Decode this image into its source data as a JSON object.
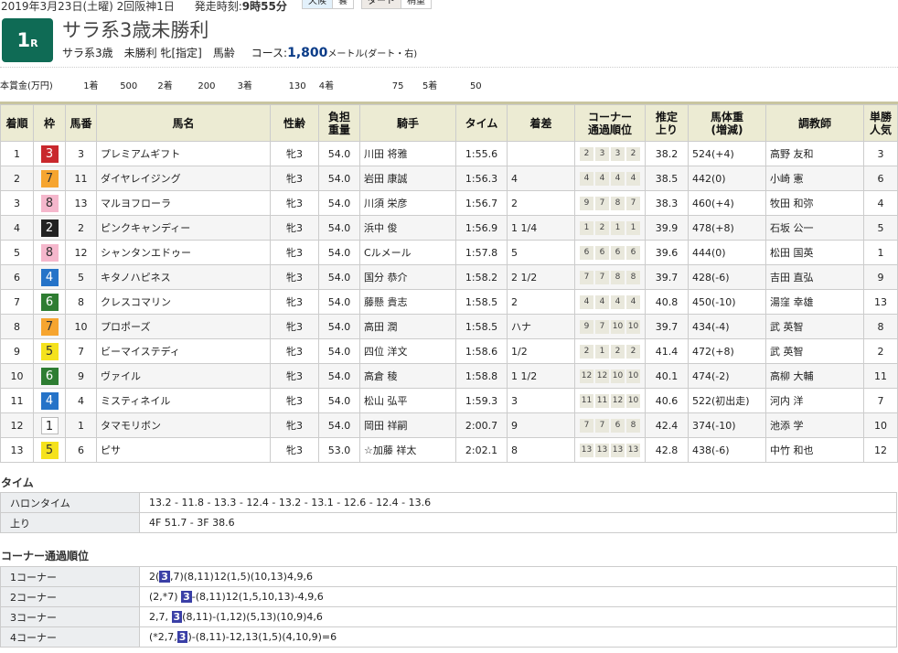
{
  "header": {
    "date_line": "2019年3月23日(土曜) 2回阪神1日",
    "start_label": "発走時刻:",
    "start_time": "9時55分",
    "weather_label": "天候",
    "weather": "曇",
    "track_label": "ダート",
    "track_condition": "稍重",
    "race_number": "1",
    "race_suffix": "R",
    "race_title": "サラ系3歳未勝利",
    "conditions": "サラ系3歳　未勝利 牝[指定]　馬齢",
    "course_label": "コース:",
    "distance": "1,800",
    "course_suffix": "メートル(ダート・右)"
  },
  "prize": {
    "label": "本賞金(万円)",
    "items": [
      {
        "place": "1着",
        "amount": "500"
      },
      {
        "place": "2着",
        "amount": "200"
      },
      {
        "place": "3着",
        "amount": "130"
      },
      {
        "place": "4着",
        "amount": "75"
      },
      {
        "place": "5着",
        "amount": "50"
      }
    ]
  },
  "columns": [
    "着順",
    "枠",
    "馬番",
    "馬名",
    "性齢",
    "負担\n重量",
    "騎手",
    "タイム",
    "着差",
    "コーナー\n通過順位",
    "推定\n上り",
    "馬体重\n(増減)",
    "調教師",
    "単勝\n人気"
  ],
  "waku_colors": {
    "1": {
      "bg": "#ffffff",
      "fg": "#222222"
    },
    "2": {
      "bg": "#222222",
      "fg": "#ffffff"
    },
    "3": {
      "bg": "#c9282d",
      "fg": "#ffffff"
    },
    "4": {
      "bg": "#2573c8",
      "fg": "#ffffff"
    },
    "5": {
      "bg": "#f5e21c",
      "fg": "#333333"
    },
    "6": {
      "bg": "#2e7d32",
      "fg": "#ffffff"
    },
    "7": {
      "bg": "#f6a530",
      "fg": "#333333"
    },
    "8": {
      "bg": "#f5b7cc",
      "fg": "#333333"
    }
  },
  "results": [
    {
      "pos": "1",
      "waku": "3",
      "num": "3",
      "name": "プレミアムギフト",
      "sexage": "牝3",
      "weight": "54.0",
      "jockey": "川田 将雅",
      "time": "1:55.6",
      "margin": "",
      "pass": [
        "2",
        "3",
        "3",
        "2"
      ],
      "last3f": "38.2",
      "body": "524(+4)",
      "trainer": "高野 友和",
      "pop": "3"
    },
    {
      "pos": "2",
      "waku": "7",
      "num": "11",
      "name": "ダイヤレイジング",
      "sexage": "牝3",
      "weight": "54.0",
      "jockey": "岩田 康誠",
      "time": "1:56.3",
      "margin": "4",
      "pass": [
        "4",
        "4",
        "4",
        "4"
      ],
      "last3f": "38.5",
      "body": "442(0)",
      "trainer": "小崎 憲",
      "pop": "6"
    },
    {
      "pos": "3",
      "waku": "8",
      "num": "13",
      "name": "マルヨフローラ",
      "sexage": "牝3",
      "weight": "54.0",
      "jockey": "川須 栄彦",
      "time": "1:56.7",
      "margin": "2",
      "pass": [
        "9",
        "7",
        "8",
        "7"
      ],
      "last3f": "38.3",
      "body": "460(+4)",
      "trainer": "牧田 和弥",
      "pop": "4"
    },
    {
      "pos": "4",
      "waku": "2",
      "num": "2",
      "name": "ピンクキャンディー",
      "sexage": "牝3",
      "weight": "54.0",
      "jockey": "浜中 俊",
      "time": "1:56.9",
      "margin": "1 1/4",
      "pass": [
        "1",
        "2",
        "1",
        "1"
      ],
      "last3f": "39.9",
      "body": "478(+8)",
      "trainer": "石坂 公一",
      "pop": "5"
    },
    {
      "pos": "5",
      "waku": "8",
      "num": "12",
      "name": "シャンタンエドゥー",
      "sexage": "牝3",
      "weight": "54.0",
      "jockey": "Cルメール",
      "time": "1:57.8",
      "margin": "5",
      "pass": [
        "6",
        "6",
        "6",
        "6"
      ],
      "last3f": "39.6",
      "body": "444(0)",
      "trainer": "松田 国英",
      "pop": "1"
    },
    {
      "pos": "6",
      "waku": "4",
      "num": "5",
      "name": "キタノハピネス",
      "sexage": "牝3",
      "weight": "54.0",
      "jockey": "国分 恭介",
      "time": "1:58.2",
      "margin": "2 1/2",
      "pass": [
        "7",
        "7",
        "8",
        "8"
      ],
      "last3f": "39.7",
      "body": "428(-6)",
      "trainer": "吉田 直弘",
      "pop": "9"
    },
    {
      "pos": "7",
      "waku": "6",
      "num": "8",
      "name": "クレスコマリン",
      "sexage": "牝3",
      "weight": "54.0",
      "jockey": "藤懸 貴志",
      "time": "1:58.5",
      "margin": "2",
      "pass": [
        "4",
        "4",
        "4",
        "4"
      ],
      "last3f": "40.8",
      "body": "450(-10)",
      "trainer": "湯窪 幸雄",
      "pop": "13"
    },
    {
      "pos": "8",
      "waku": "7",
      "num": "10",
      "name": "プロポーズ",
      "sexage": "牝3",
      "weight": "54.0",
      "jockey": "高田 潤",
      "time": "1:58.5",
      "margin": "ハナ",
      "pass": [
        "9",
        "7",
        "10",
        "10"
      ],
      "last3f": "39.7",
      "body": "434(-4)",
      "trainer": "武 英智",
      "pop": "8"
    },
    {
      "pos": "9",
      "waku": "5",
      "num": "7",
      "name": "ビーマイステディ",
      "sexage": "牝3",
      "weight": "54.0",
      "jockey": "四位 洋文",
      "time": "1:58.6",
      "margin": "1/2",
      "pass": [
        "2",
        "1",
        "2",
        "2"
      ],
      "last3f": "41.4",
      "body": "472(+8)",
      "trainer": "武 英智",
      "pop": "2"
    },
    {
      "pos": "10",
      "waku": "6",
      "num": "9",
      "name": "ヴァイル",
      "sexage": "牝3",
      "weight": "54.0",
      "jockey": "高倉 稜",
      "time": "1:58.8",
      "margin": "1 1/2",
      "pass": [
        "12",
        "12",
        "10",
        "10"
      ],
      "last3f": "40.1",
      "body": "474(-2)",
      "trainer": "高柳 大輔",
      "pop": "11"
    },
    {
      "pos": "11",
      "waku": "4",
      "num": "4",
      "name": "ミスティネイル",
      "sexage": "牝3",
      "weight": "54.0",
      "jockey": "松山 弘平",
      "time": "1:59.3",
      "margin": "3",
      "pass": [
        "11",
        "11",
        "12",
        "10"
      ],
      "last3f": "40.6",
      "body": "522(初出走)",
      "trainer": "河内 洋",
      "pop": "7"
    },
    {
      "pos": "12",
      "waku": "1",
      "num": "1",
      "name": "タマモリボン",
      "sexage": "牝3",
      "weight": "54.0",
      "jockey": "岡田 祥嗣",
      "time": "2:00.7",
      "margin": "9",
      "pass": [
        "7",
        "7",
        "6",
        "8"
      ],
      "last3f": "42.4",
      "body": "374(-10)",
      "trainer": "池添 学",
      "pop": "10"
    },
    {
      "pos": "13",
      "waku": "5",
      "num": "6",
      "name": "ピサ",
      "sexage": "牝3",
      "weight": "53.0",
      "jockey": "☆加藤 祥太",
      "time": "2:02.1",
      "margin": "8",
      "pass": [
        "13",
        "13",
        "13",
        "13"
      ],
      "last3f": "42.8",
      "body": "438(-6)",
      "trainer": "中竹 和也",
      "pop": "12"
    }
  ],
  "time_section": {
    "title": "タイム",
    "rows": [
      {
        "label": "ハロンタイム",
        "value": "13.2 - 11.8 - 13.3 - 12.4 - 13.2 - 13.1 - 12.6 - 12.4 - 13.6"
      },
      {
        "label": "上り",
        "value": "4F 51.7 - 3F 38.6"
      }
    ]
  },
  "corner_section": {
    "title": "コーナー通過順位",
    "highlight": "3",
    "rows": [
      {
        "label": "1コーナー",
        "before": "2(",
        "after": ",7)(8,11)12(1,5)(10,13)4,9,6"
      },
      {
        "label": "2コーナー",
        "before": "(2,*7) ",
        "after": "-(8,11)12(1,5,10,13)-4,9,6"
      },
      {
        "label": "3コーナー",
        "before": "2,7, ",
        "after": "(8,11)-(1,12)(5,13)(10,9)4,6"
      },
      {
        "label": "4コーナー",
        "before": "(*2,7,",
        "after": ")-(8,11)-12,13(1,5)(4,10,9)=6"
      }
    ]
  }
}
